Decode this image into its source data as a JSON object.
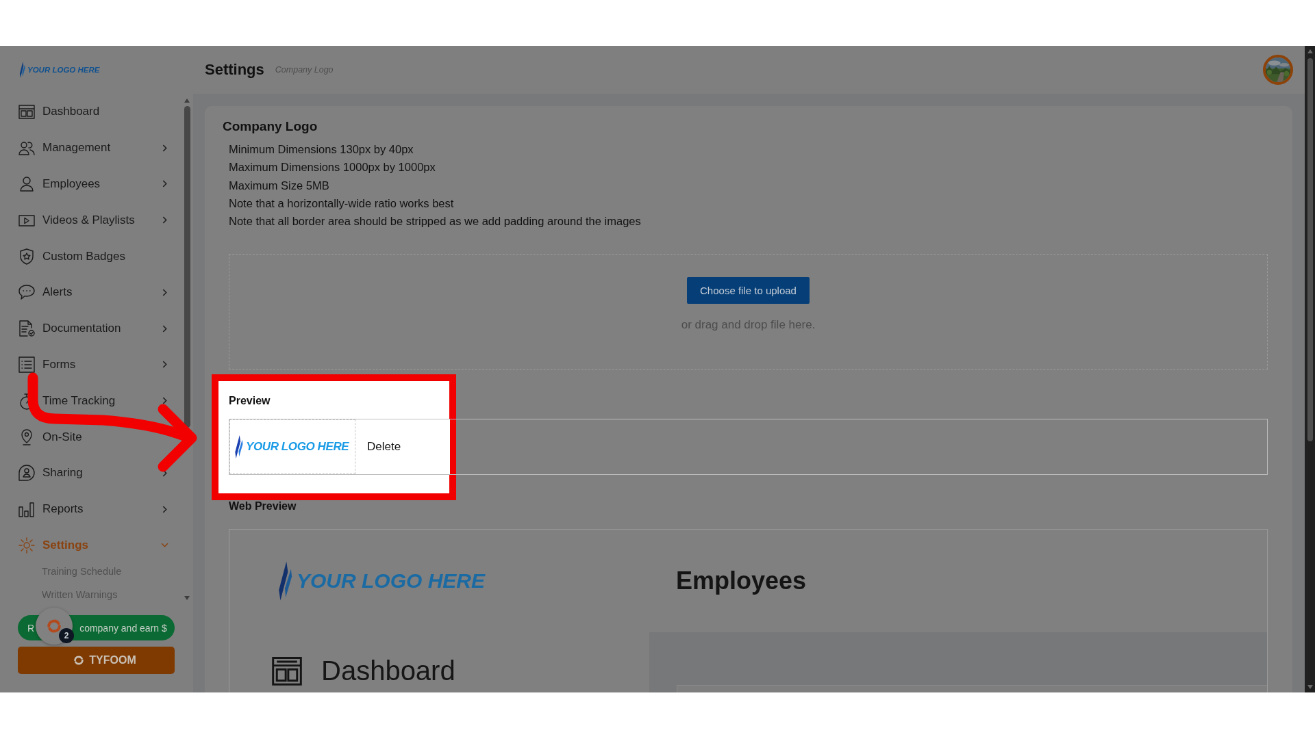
{
  "brand_logo": {
    "text": "YOUR LOGO HERE"
  },
  "sidebar": {
    "items": [
      {
        "label": "Dashboard",
        "submenu": false,
        "selected": false
      },
      {
        "label": "Management",
        "submenu": true,
        "expanded": false,
        "selected": false
      },
      {
        "label": "Employees",
        "submenu": true,
        "expanded": false,
        "selected": false
      },
      {
        "label": "Videos & Playlists",
        "submenu": true,
        "expanded": false,
        "selected": false
      },
      {
        "label": "Custom Badges",
        "submenu": false,
        "selected": false
      },
      {
        "label": "Alerts",
        "submenu": true,
        "expanded": false,
        "selected": false
      },
      {
        "label": "Documentation",
        "submenu": true,
        "expanded": false,
        "selected": false
      },
      {
        "label": "Forms",
        "submenu": true,
        "expanded": false,
        "selected": false
      },
      {
        "label": "Time Tracking",
        "submenu": true,
        "expanded": false,
        "selected": false
      },
      {
        "label": "On-Site",
        "submenu": false,
        "selected": false
      },
      {
        "label": "Sharing",
        "submenu": true,
        "expanded": false,
        "selected": false
      },
      {
        "label": "Reports",
        "submenu": true,
        "expanded": false,
        "selected": false
      },
      {
        "label": "Settings",
        "submenu": true,
        "expanded": true,
        "selected": true,
        "children": [
          {
            "label": "Training Schedule"
          },
          {
            "label": "Written Warnings"
          }
        ]
      }
    ]
  },
  "refer_button": {
    "text_parts": [
      "R",
      "company and earn $"
    ]
  },
  "tyfoom_button": {
    "label": "TYFOOM"
  },
  "chat_badge": {
    "count": "2"
  },
  "header": {
    "title": "Settings",
    "breadcrumb": "Company Logo"
  },
  "card": {
    "title": "Company Logo",
    "notes": [
      "Minimum Dimensions 130px by 40px",
      "Maximum Dimensions 1000px by 1000px",
      "Maximum Size 5MB",
      "Note that a horizontally-wide ratio works best",
      "Note that all border area should be stripped as we add padding around the images"
    ],
    "upload": {
      "button": "Choose file to upload",
      "hint": "or drag and drop file here."
    },
    "preview": {
      "label": "Preview",
      "logo_text": "YOUR LOGO HERE",
      "delete": "Delete",
      "highlighted": true
    },
    "web_preview": {
      "label": "Web Preview",
      "logo_text": "YOUR LOGO HERE",
      "heading": "Employees",
      "menu_item": "Dashboard"
    }
  }
}
